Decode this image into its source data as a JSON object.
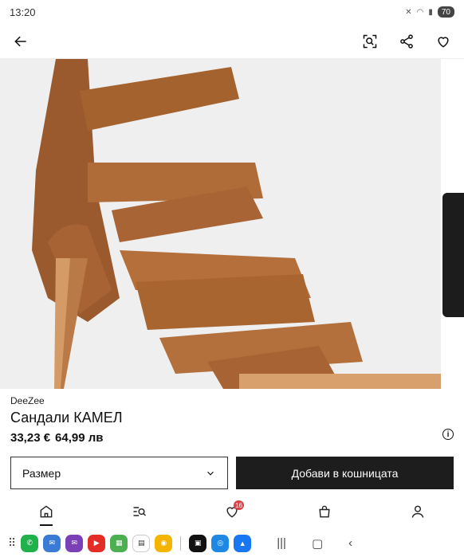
{
  "status_bar": {
    "time": "13:20",
    "battery": "70"
  },
  "product": {
    "brand": "DeeZee",
    "name": "Сандали КАМЕЛ",
    "price_eur": "33,23 €",
    "price_bgn": "64,99 лв"
  },
  "actions": {
    "size_label": "Размер",
    "add_to_cart_label": "Добави в кошницата"
  },
  "bottom_nav": {
    "wishlist_badge": "16"
  },
  "icons": {
    "back": "arrow-left-icon",
    "visual_search": "visual-search-icon",
    "share": "share-icon",
    "wishlist": "heart-icon",
    "info": "info-icon",
    "dropdown": "chevron-down-icon"
  },
  "colors": {
    "button_dark": "#1d1d1d",
    "badge": "#d9434a",
    "product_bg": "#efefef"
  }
}
